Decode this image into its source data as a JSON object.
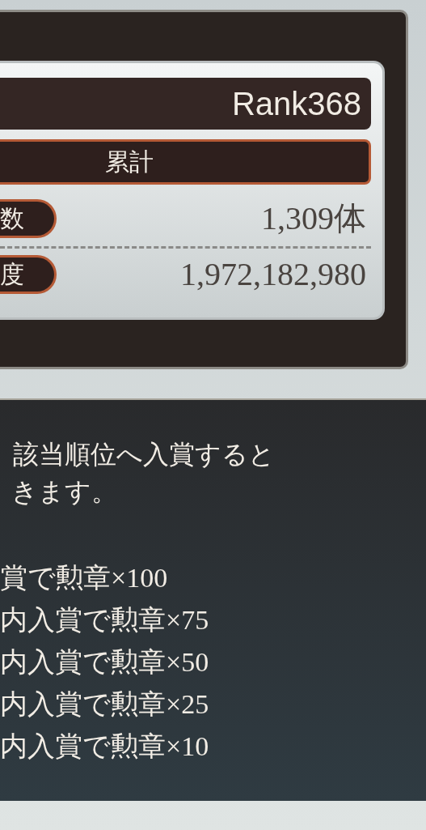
{
  "ranking_panel": {
    "rank": "Rank368",
    "section_header": "累計",
    "rows": [
      {
        "label": "数",
        "value": "1,309体"
      },
      {
        "label": "度",
        "value": "1,972,182,980"
      }
    ]
  },
  "reward_info": {
    "intro_lines": [
      "該当順位へ入賞すると",
      "きます。"
    ],
    "rewards": [
      "賞で勲章×100",
      "内入賞で勲章×75",
      "内入賞で勲章×50",
      "内入賞で勲章×25",
      "内入賞で勲章×10"
    ]
  }
}
